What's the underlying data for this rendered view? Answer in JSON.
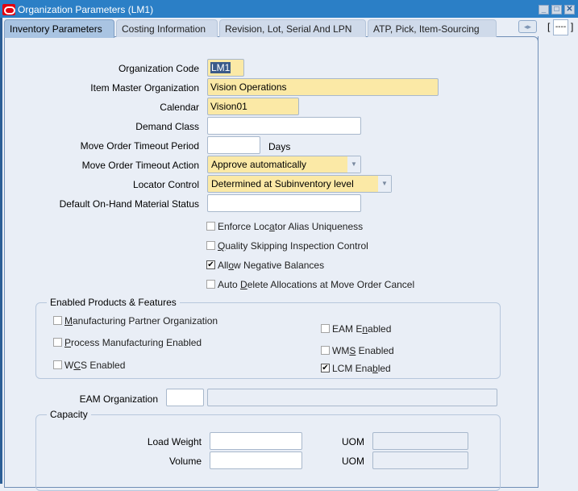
{
  "window": {
    "title": "Organization Parameters (LM1)",
    "controls": {
      "minimize": "_",
      "maximize": "□",
      "close": "✕"
    }
  },
  "tabs": [
    {
      "label": "Inventory Parameters",
      "active": true
    },
    {
      "label": "Costing Information",
      "active": false
    },
    {
      "label": "Revision, Lot, Serial And LPN",
      "active": false
    },
    {
      "label": "ATP, Pick, Item-Sourcing",
      "active": false
    }
  ],
  "tab_scroll_icon": "◂▸",
  "record_indicator": {
    "open": "[",
    "value": "----",
    "close": "]"
  },
  "form": {
    "organization_code": {
      "label": "Organization Code",
      "value": "LM1"
    },
    "item_master_org": {
      "label": "Item Master Organization",
      "value": "Vision Operations"
    },
    "calendar": {
      "label": "Calendar",
      "value": "Vision01"
    },
    "demand_class": {
      "label": "Demand Class",
      "value": ""
    },
    "move_order_timeout_period": {
      "label": "Move Order Timeout Period",
      "value": "",
      "unit": "Days"
    },
    "move_order_timeout_action": {
      "label": "Move Order Timeout Action",
      "value": "Approve automatically"
    },
    "locator_control": {
      "label": "Locator Control",
      "value": "Determined at Subinventory level"
    },
    "default_onhand_status": {
      "label": "Default On-Hand Material Status",
      "value": ""
    }
  },
  "checkboxes": [
    {
      "pre": "Enforce Loc",
      "u": "a",
      "post": "tor Alias Uniqueness",
      "checked": false
    },
    {
      "pre": "",
      "u": "Q",
      "post": "uality Skipping Inspection Control",
      "checked": false
    },
    {
      "pre": "All",
      "u": "o",
      "post": "w Negative Balances",
      "checked": true
    },
    {
      "pre": "Auto ",
      "u": "D",
      "post": "elete Allocations at Move Order Cancel",
      "checked": false
    }
  ],
  "enabled_products": {
    "title": "Enabled Products & Features",
    "items": [
      {
        "pre": "",
        "u": "M",
        "post": "anufacturing Partner Organization",
        "checked": false
      },
      {
        "pre": "",
        "u": "P",
        "post": "rocess Manufacturing Enabled",
        "checked": false
      },
      {
        "pre": "W",
        "u": "C",
        "post": "S Enabled",
        "checked": false
      },
      {
        "pre": "EAM E",
        "u": "n",
        "post": "abled",
        "checked": false
      },
      {
        "pre": "WM",
        "u": "S",
        "post": " Enabled",
        "checked": false
      },
      {
        "pre": "LCM Ena",
        "u": "b",
        "post": "led",
        "checked": true
      }
    ]
  },
  "eam_organization": {
    "label": "EAM Organization",
    "code": "",
    "name": ""
  },
  "capacity": {
    "title": "Capacity",
    "load_weight": {
      "label": "Load Weight",
      "value": "",
      "uom_label": "UOM",
      "uom": ""
    },
    "volume": {
      "label": "Volume",
      "value": "",
      "uom_label": "UOM",
      "uom": ""
    }
  },
  "check_glyph": "✔"
}
